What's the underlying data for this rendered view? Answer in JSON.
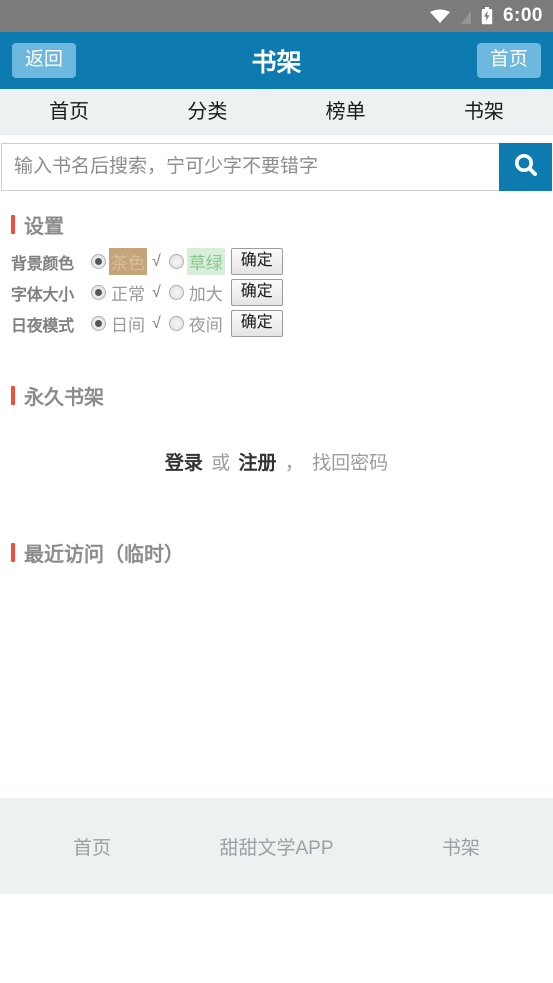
{
  "statusbar": {
    "time": "6:00",
    "icons": [
      "wifi-icon",
      "signal-off-icon",
      "battery-charging-icon"
    ]
  },
  "appbar": {
    "back_label": "返回",
    "title": "书架",
    "home_label": "首页",
    "background": "#0d7bb0",
    "button_background": "#6cb8de"
  },
  "tabnav": {
    "items": [
      {
        "label": "首页"
      },
      {
        "label": "分类"
      },
      {
        "label": "榜单"
      },
      {
        "label": "书架"
      }
    ]
  },
  "search": {
    "value": "",
    "placeholder": "输入书名后搜索，宁可少字不要错字",
    "button_icon": "search-icon"
  },
  "settings": {
    "title": "设置",
    "confirm_label": "确定",
    "tick": "√",
    "rows": [
      {
        "label": "背景颜色",
        "options": [
          {
            "text": "茶色",
            "selected": true,
            "swatch": "#c6a479"
          },
          {
            "text": "草绿",
            "selected": false,
            "swatch": "#d9eed9"
          }
        ]
      },
      {
        "label": "字体大小",
        "options": [
          {
            "text": "正常",
            "selected": true
          },
          {
            "text": "加大",
            "selected": false
          }
        ]
      },
      {
        "label": "日夜模式",
        "options": [
          {
            "text": "日间",
            "selected": true
          },
          {
            "text": "夜间",
            "selected": false
          }
        ]
      }
    ]
  },
  "permanent_shelf": {
    "title": "永久书架",
    "login_label": "登录",
    "or_label": "或",
    "register_label": "注册",
    "comma": "，",
    "forgot_label": "找回密码"
  },
  "recent": {
    "title": "最近访问（临时）"
  },
  "footer": {
    "items": [
      {
        "label": "首页"
      },
      {
        "label": "甜甜文学APP"
      },
      {
        "label": "书架"
      }
    ]
  },
  "accent_colors": {
    "brand_blue": "#0d7bb0",
    "section_bar_red": "#f0503a",
    "panel_gray": "#edf1f2",
    "muted_text": "#9aa1a5"
  }
}
